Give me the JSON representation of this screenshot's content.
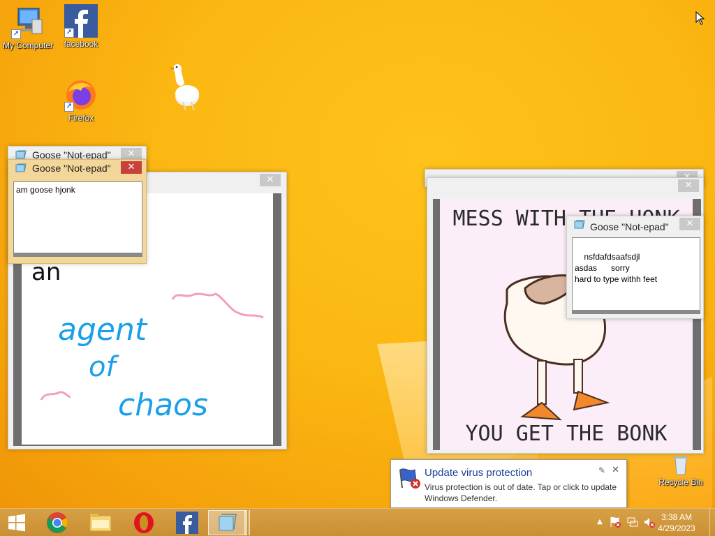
{
  "desktop": {
    "icons": [
      {
        "label": "My Computer"
      },
      {
        "label": "facebook"
      },
      {
        "label": "Firefox"
      },
      {
        "label": "Recycle Bin"
      }
    ]
  },
  "windows": {
    "notepad_back": {
      "title": "Goose \"Not-epad\""
    },
    "notepad_front": {
      "title": "Goose \"Not-epad\"",
      "text": "am goose hjonk"
    },
    "notepad_right": {
      "title": "Goose \"Not-epad\"",
      "text": "nsfdafdsaafsdjl\nasdas      sorry\nhard to type withh feet"
    },
    "drawing": {
      "words": [
        "an",
        "agent",
        "of",
        "chaos"
      ]
    },
    "meme": {
      "top_text": "MESS WITH THE HONK",
      "bottom_text": "YOU GET THE BONK"
    }
  },
  "toast": {
    "title": "Update virus protection",
    "body": "Virus protection is out of date. Tap or click to update Windows Defender."
  },
  "taskbar": {
    "time": "3:38 AM",
    "date": "4/29/2023"
  },
  "colors": {
    "desktop": "#fbb712",
    "taskbar": "#cf9439",
    "close_red": "#c7423a",
    "note_frame": "#f3d69a"
  }
}
